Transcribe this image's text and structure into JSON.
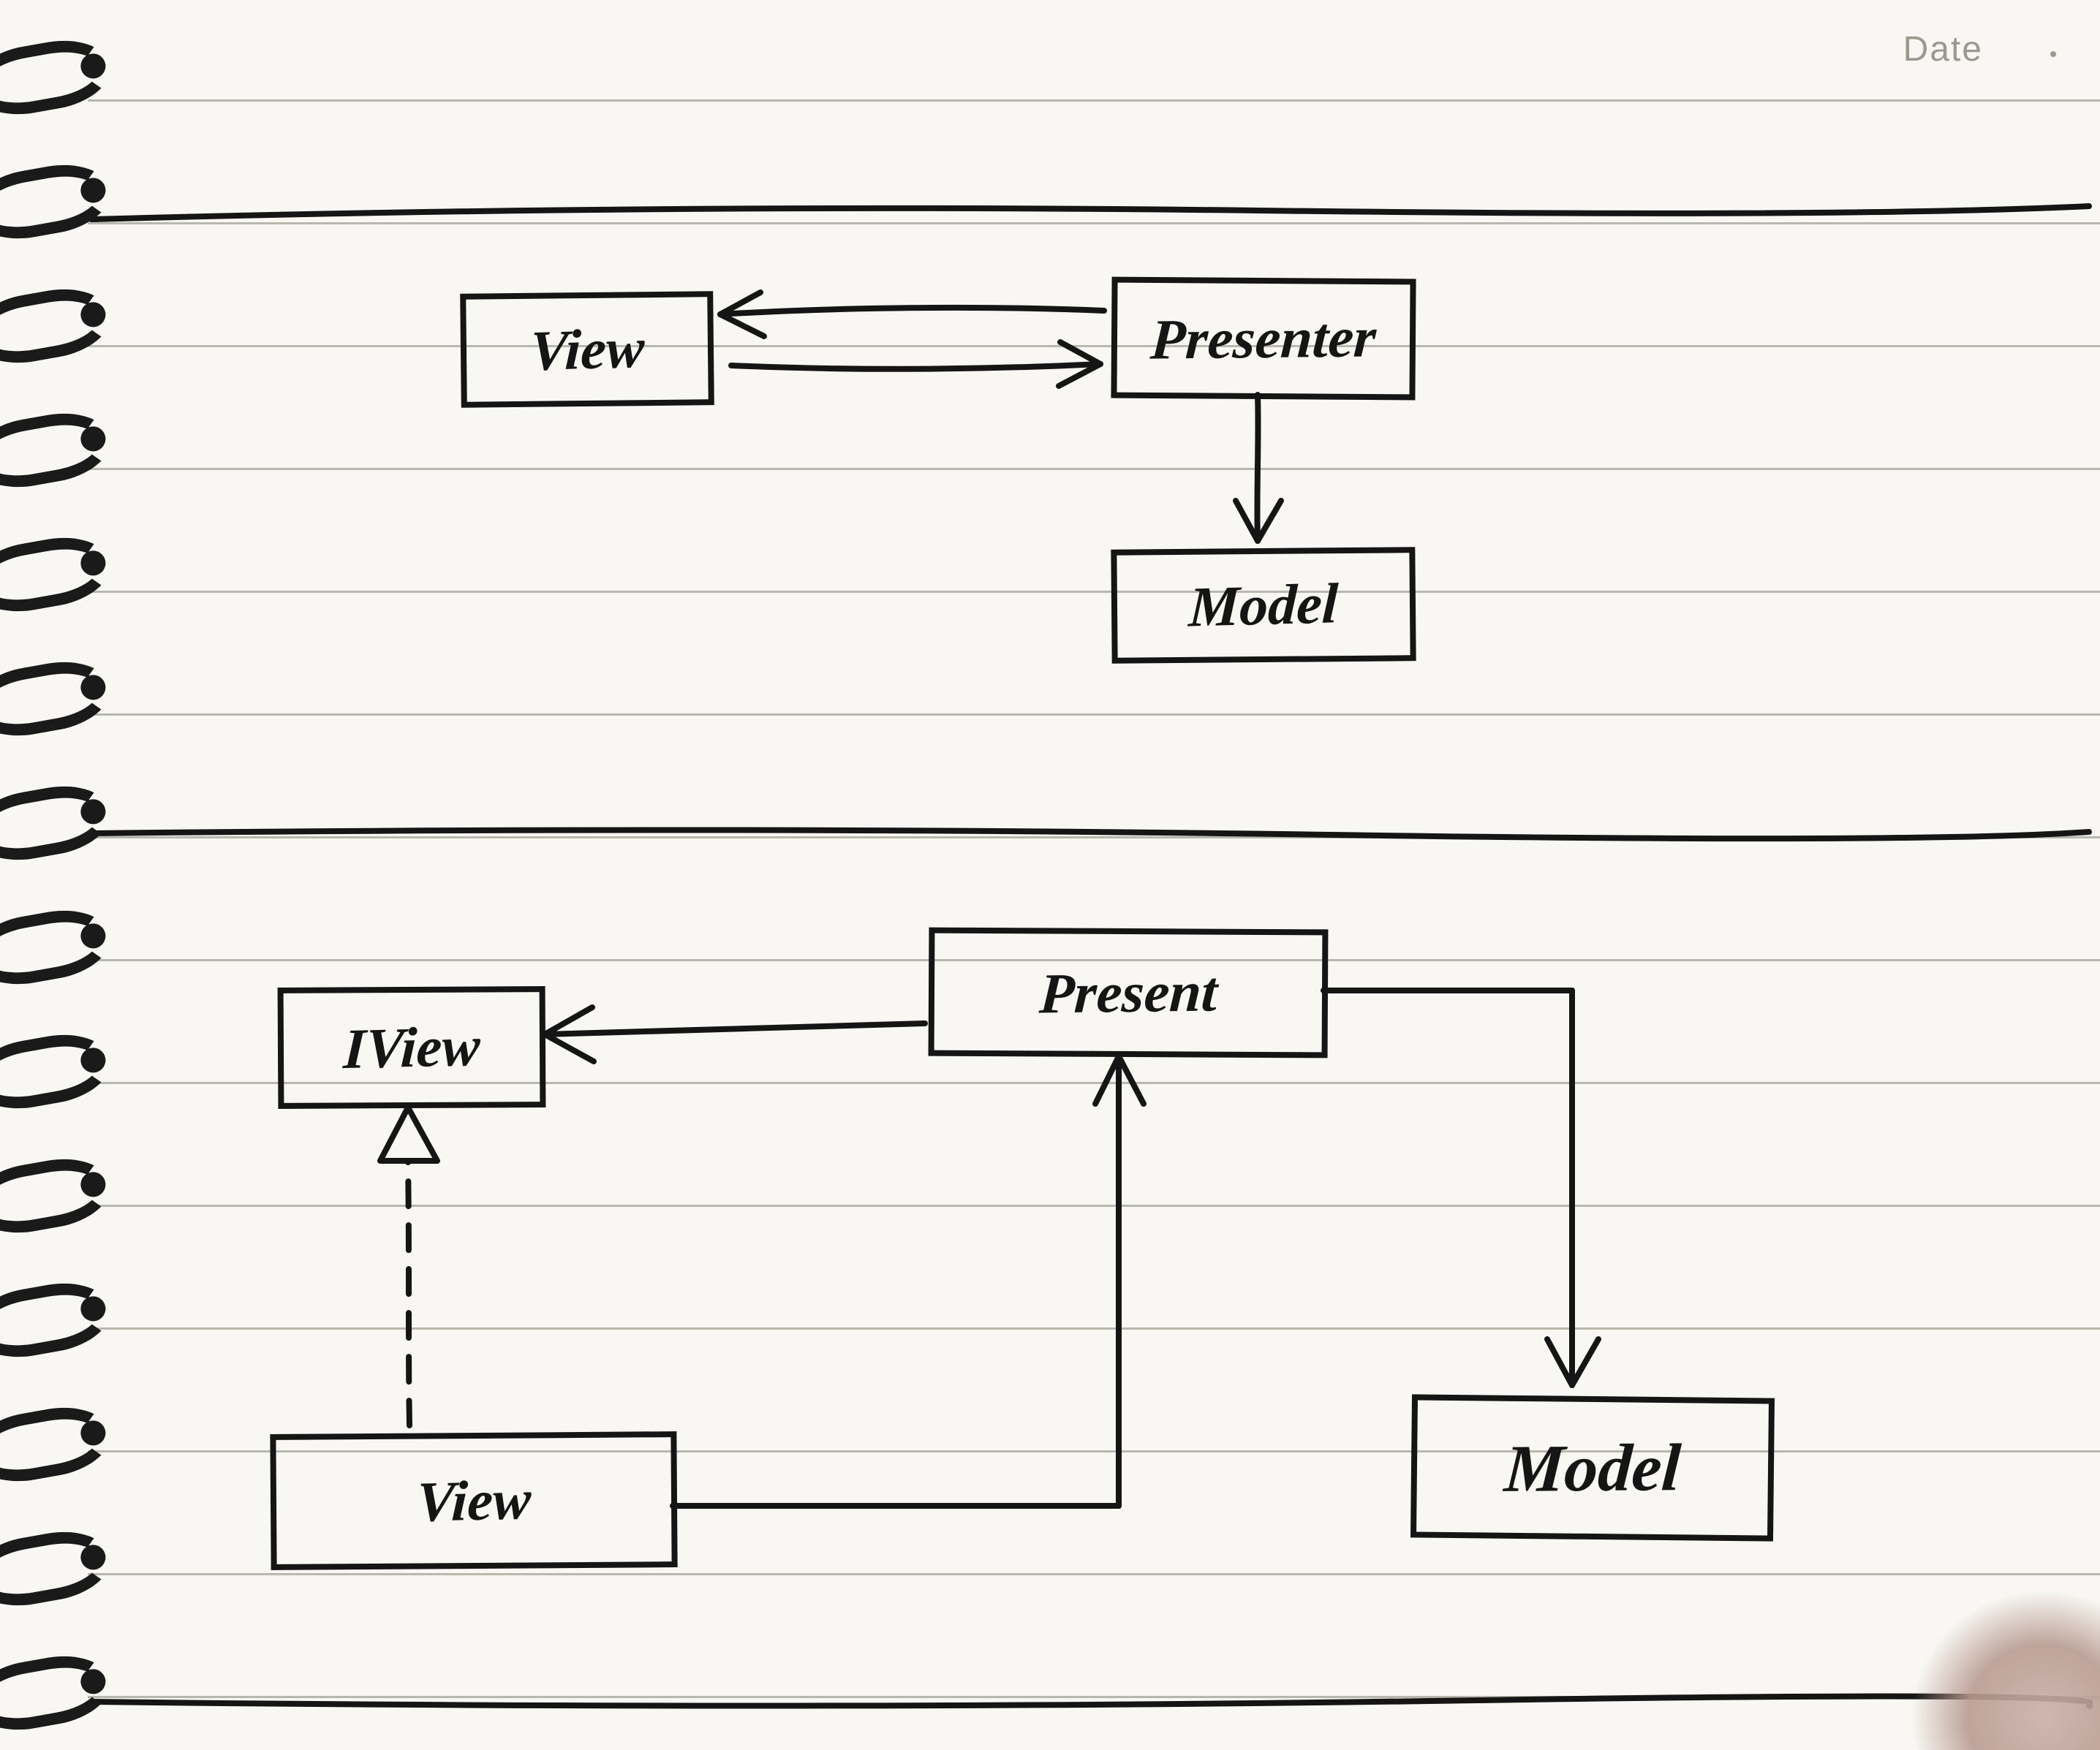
{
  "header": {
    "date_label": "Date"
  },
  "diagram1": {
    "nodes": {
      "view": {
        "label": "View"
      },
      "presenter": {
        "label": "Presenter"
      },
      "model": {
        "label": "Model"
      }
    },
    "edges": [
      {
        "from": "view",
        "to": "presenter",
        "style": "bidirectional-solid"
      },
      {
        "from": "presenter",
        "to": "model",
        "style": "arrow-solid"
      }
    ]
  },
  "diagram2": {
    "nodes": {
      "iview": {
        "label": "IView"
      },
      "present": {
        "label": "Present"
      },
      "view": {
        "label": "View"
      },
      "model": {
        "label": "Model"
      }
    },
    "edges": [
      {
        "from": "present",
        "to": "iview",
        "style": "arrow-solid"
      },
      {
        "from": "view",
        "to": "iview",
        "style": "arrow-dashed-hollow"
      },
      {
        "from": "view",
        "to": "present",
        "style": "arrow-solid"
      },
      {
        "from": "present",
        "to": "model",
        "style": "arrow-solid"
      }
    ]
  }
}
